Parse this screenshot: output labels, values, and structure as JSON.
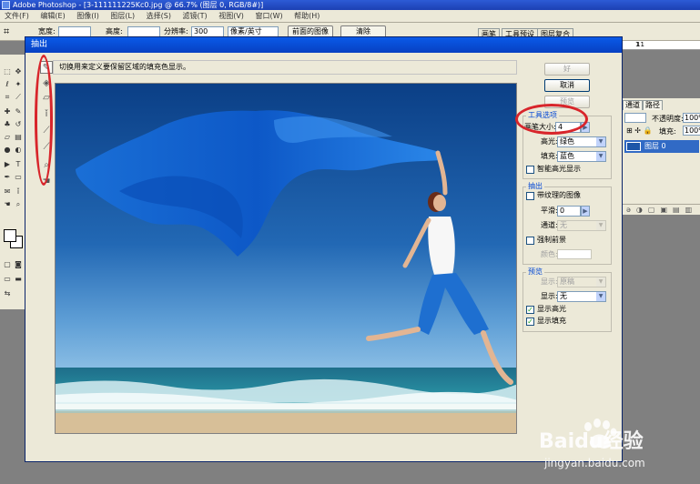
{
  "photoshop": {
    "title": "Adobe Photoshop - [3-111111225Kc0.jpg @ 66.7% (图层 0, RGB/8#)]",
    "menu": [
      "文件(F)",
      "编辑(E)",
      "图像(I)",
      "图层(L)",
      "选择(S)",
      "滤镜(T)",
      "视图(V)",
      "窗口(W)",
      "帮助(H)"
    ],
    "options": {
      "width_label": "宽度:",
      "height_label": "高度:",
      "resolution_label": "分辨率:",
      "resolution_value": "300",
      "resolution_unit": "像素/英寸",
      "front_image_button": "前面的图像",
      "clear_button": "清除"
    },
    "palette_tabs": [
      "画笔",
      "工具预设",
      "图层复合"
    ],
    "ruler_labels": [
      "1",
      "11"
    ],
    "layers": {
      "tabs": [
        "通道",
        "路径"
      ],
      "opacity_label": "不透明度:",
      "opacity_value": "100%",
      "fill_label": "填充:",
      "fill_value": "100%",
      "layer_name": "图层 0"
    }
  },
  "dialog": {
    "title": "抽出",
    "hint": "切换用来定义要保留区域的填充色显示。",
    "buttons": {
      "ok": "好",
      "cancel": "取消",
      "preview": "预览"
    },
    "tool_options": {
      "title": "工具选项",
      "brush_size_label": "画笔大小:",
      "brush_size_value": "4",
      "highlight_label": "高光:",
      "highlight_value": "绿色",
      "fill_label": "填充:",
      "fill_value": "蓝色",
      "smart_highlight": "智能高光显示"
    },
    "extract": {
      "title": "抽出",
      "textured_image": "带纹理的图像",
      "smooth_label": "平滑:",
      "smooth_value": "0",
      "channel_label": "通道:",
      "channel_value": "无",
      "force_foreground": "强制前景",
      "color_label": "颜色:"
    },
    "preview": {
      "title": "预览",
      "show_label": "显示:",
      "show_value": "原稿",
      "display_label": "显示:",
      "display_value": "无",
      "show_highlight": "显示高光",
      "show_fill": "显示填充",
      "show_highlight_checked": true,
      "show_fill_checked": true
    }
  },
  "watermark": {
    "brand": "Baidu经验",
    "url": "jingyan.baidu.com"
  },
  "colors": {
    "annotation": "#d8252b",
    "dialog_bg": "#ece9d8",
    "title_blue": "#0a5ae8",
    "group_title": "#0046d5"
  }
}
